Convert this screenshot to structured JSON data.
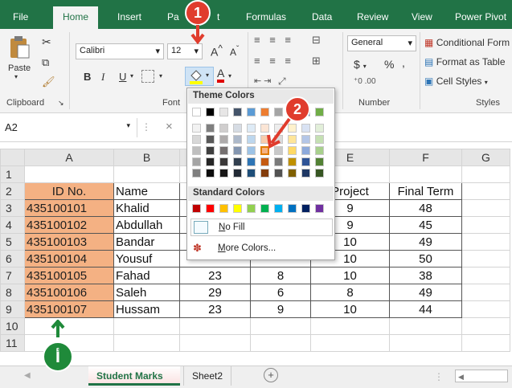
{
  "ribbon_tabs": [
    "File",
    "Home",
    "Insert",
    "Pa",
    "t",
    "Formulas",
    "Data",
    "Review",
    "View",
    "Power Pivot"
  ],
  "clipboard": {
    "paste_label": "Paste",
    "group_label": "Clipboard"
  },
  "font": {
    "font_name": "Calibri",
    "font_size": "12",
    "group_label": "Font",
    "bold": "B",
    "italic": "I",
    "underline": "U",
    "grow": "A",
    "shrink": "A",
    "font_color": "A"
  },
  "number": {
    "format": "General",
    "currency": "$",
    "percent": "%",
    "comma": ",",
    "group_label": "Number"
  },
  "styles": {
    "conditional": "Conditional Form",
    "table": "Format as Table",
    "cell_styles": "Cell Styles",
    "group_label": "Styles"
  },
  "formula_bar": {
    "name_box": "A2",
    "cancel": "×"
  },
  "columns": [
    "A",
    "B",
    "",
    "",
    "E",
    "F",
    "G"
  ],
  "rows": [
    {
      "num": "1",
      "a": "",
      "b": "",
      "c": "",
      "d": "",
      "e": "",
      "f": ""
    },
    {
      "num": "2",
      "a": "ID No.",
      "b": "Name",
      "c": "",
      "d": "",
      "e": "Project",
      "f": "Final Term"
    },
    {
      "num": "3",
      "a": "435100101",
      "b": "Khalid",
      "c": "",
      "d": "",
      "e": "9",
      "f": "48"
    },
    {
      "num": "4",
      "a": "435100102",
      "b": "Abdullah",
      "c": "",
      "d": "",
      "e": "9",
      "f": "45"
    },
    {
      "num": "5",
      "a": "435100103",
      "b": "Bandar",
      "c": "",
      "d": "",
      "e": "10",
      "f": "49"
    },
    {
      "num": "6",
      "a": "435100104",
      "b": "Yousuf",
      "c": "",
      "d": "",
      "e": "10",
      "f": "50"
    },
    {
      "num": "7",
      "a": "435100105",
      "b": "Fahad",
      "c": "23",
      "d": "8",
      "e": "10",
      "f": "38"
    },
    {
      "num": "8",
      "a": "435100106",
      "b": "Saleh",
      "c": "29",
      "d": "6",
      "e": "8",
      "f": "49"
    },
    {
      "num": "9",
      "a": "435100107",
      "b": "Hussam",
      "c": "23",
      "d": "9",
      "e": "10",
      "f": "44"
    },
    {
      "num": "10",
      "a": "",
      "b": "",
      "c": "",
      "d": "",
      "e": "",
      "f": ""
    },
    {
      "num": "11",
      "a": "",
      "b": "",
      "c": "",
      "d": "",
      "e": "",
      "f": ""
    }
  ],
  "sheets": {
    "active": "Student Marks",
    "other": "Sheet2",
    "add": "+"
  },
  "fill_popup": {
    "theme_title": "Theme Colors",
    "standard_title": "Standard Colors",
    "no_fill": "No Fill",
    "more_colors": "More Colors...",
    "no_fill_underline": "N",
    "more_underline": "M"
  },
  "callouts": {
    "one": "1",
    "two": "2",
    "alef": "أ"
  },
  "colors": {
    "excel_green": "#217346",
    "peach": "#f4b183",
    "callout_red": "#e03c2d",
    "callout_green": "#1f8a3a"
  }
}
